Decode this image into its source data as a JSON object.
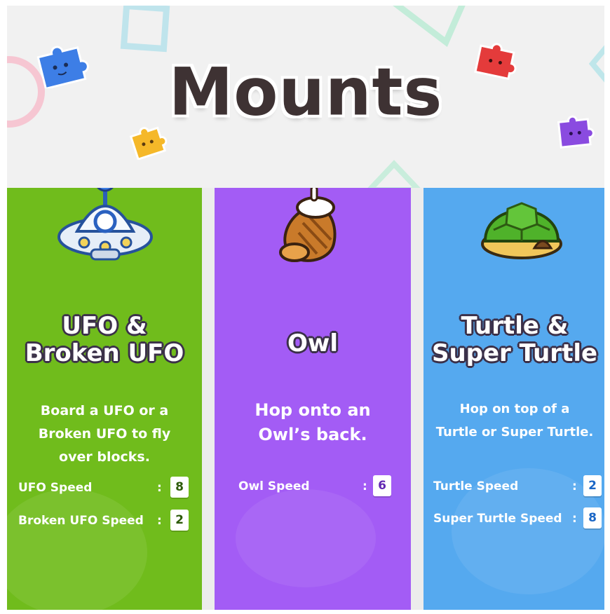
{
  "page": {
    "title": "Mounts",
    "colors": {
      "background": "#f1f1f1",
      "title_text": "#3e3233",
      "green_card": "#70bc1c",
      "purple_card": "#a35cf5",
      "blue_card": "#55a9ef"
    }
  },
  "decorations": {
    "puzzle_pieces": [
      "blue-puzzle-piece-icon",
      "yellow-puzzle-piece-icon",
      "red-puzzle-piece-icon",
      "purple-puzzle-piece-icon"
    ]
  },
  "mounts": [
    {
      "icon": "ufo-icon",
      "title_lines": [
        "UFO &",
        "Broken UFO"
      ],
      "desc_lines": [
        "Board a UFO or a",
        "Broken UFO to fly",
        "over blocks."
      ],
      "stats": [
        {
          "label": "UFO Speed",
          "value": "8"
        },
        {
          "label": "Broken UFO Speed",
          "value": "2"
        }
      ]
    },
    {
      "icon": "owl-icon",
      "title_lines": [
        "Owl"
      ],
      "desc_lines": [
        "Hop onto an",
        "Owl’s back."
      ],
      "stats": [
        {
          "label": "Owl Speed",
          "value": "6"
        }
      ]
    },
    {
      "icon": "turtle-shell-icon",
      "title_lines": [
        "Turtle &",
        "Super Turtle"
      ],
      "desc_lines": [
        "Hop on top of a",
        "Turtle or Super Turtle."
      ],
      "stats": [
        {
          "label": "Turtle Speed",
          "value": "2"
        },
        {
          "label": "Super Turtle Speed",
          "value": "8"
        }
      ]
    }
  ]
}
